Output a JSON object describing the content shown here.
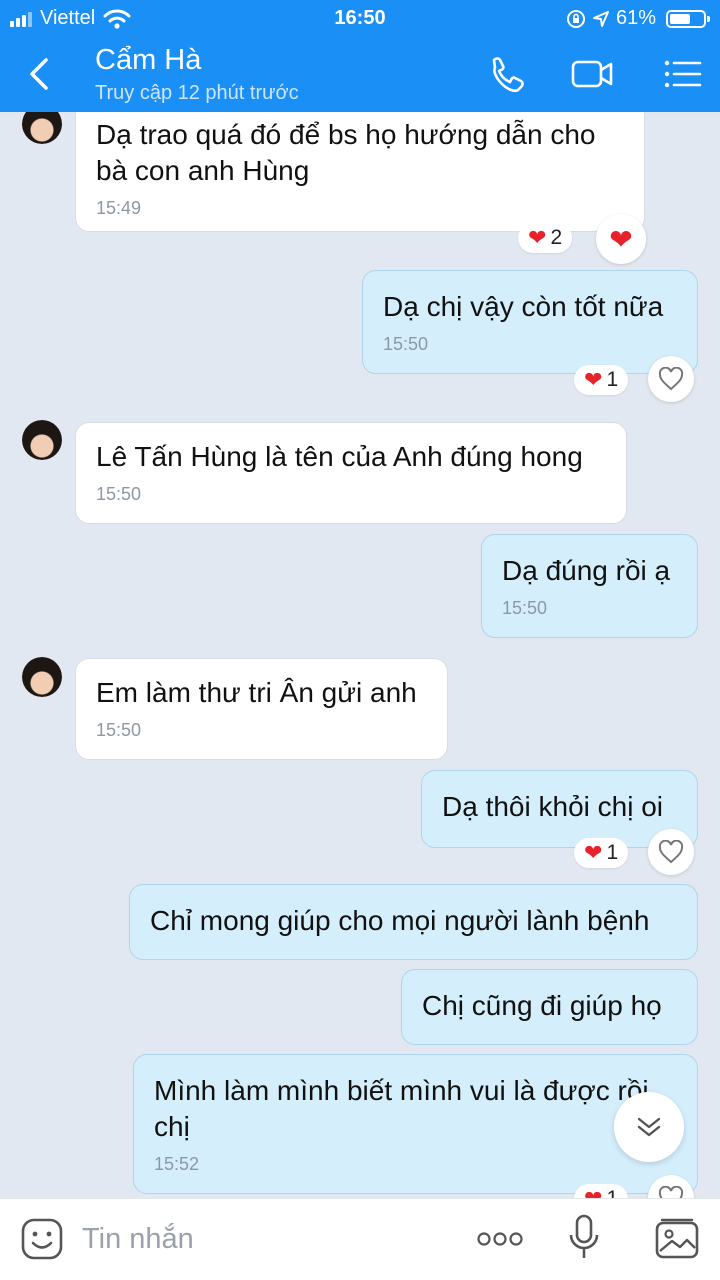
{
  "status_bar": {
    "carrier": "Viettel",
    "time": "16:50",
    "battery": "61%",
    "battery_level": 0.61
  },
  "header": {
    "title": "Cẩm Hà",
    "subtitle": "Truy cập 12 phút trước"
  },
  "messages": [
    {
      "text": "Dạ trao quá đó để bs họ hướng dẫn cho bà con anh Hùng",
      "time": "15:49",
      "reaction_count": "2"
    },
    {
      "text": "Dạ chị vậy còn tốt nữa",
      "time": "15:50",
      "reaction_count": "1"
    },
    {
      "text": "Lê Tấn Hùng là tên của Anh đúng hong",
      "time": "15:50"
    },
    {
      "text": "Dạ đúng rồi ạ",
      "time": "15:50"
    },
    {
      "text": "Em làm thư tri Ân gửi anh",
      "time": "15:50"
    },
    {
      "text": "Dạ thôi khỏi chị oi",
      "reaction_count": "1"
    },
    {
      "text": "Chỉ mong giúp cho mọi người lành bệnh"
    },
    {
      "text": "Chị cũng đi giúp họ"
    },
    {
      "text": "Mình làm mình biết mình vui là được rồi chị",
      "time": "15:52",
      "reaction_count": "1"
    }
  ],
  "input": {
    "placeholder": "Tin nhắn"
  },
  "colors": {
    "header": "#1a8ff5",
    "outgoing_bubble": "#d4eefc",
    "incoming_bubble": "#ffffff",
    "background": "#e2e8f1",
    "heart": "#e8222b"
  }
}
